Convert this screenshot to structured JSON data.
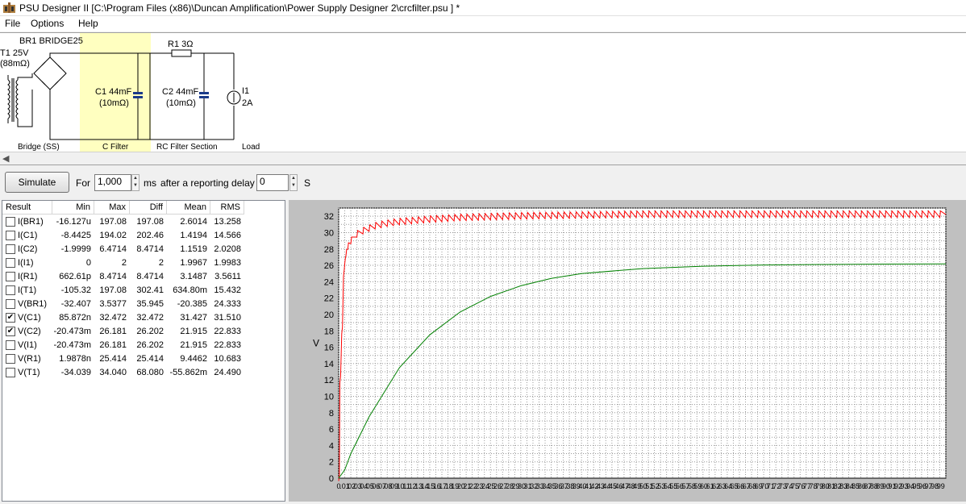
{
  "window": {
    "title": "PSU Designer II  [C:\\Program Files (x86)\\Duncan Amplification\\Power Supply Designer 2\\crcfilter.psu ] *"
  },
  "menu": {
    "file": "File",
    "options": "Options",
    "help": "Help"
  },
  "circuit": {
    "br1": "BR1 BRIDGE25",
    "t1": "T1 25V",
    "t1r": "(88mΩ)",
    "r1": "R1 3Ω",
    "c1": "C1 44mF",
    "c1r": "(10mΩ)",
    "c2": "C2 44mF",
    "c2r": "(10mΩ)",
    "i1": "I1",
    "i1v": "2A",
    "sections": {
      "bridge": "Bridge (SS)",
      "cfilter": "C Filter",
      "rc": "RC Filter Section",
      "load": "Load"
    }
  },
  "toolbar": {
    "simulate": "Simulate",
    "for": "For",
    "duration": "1,000",
    "ms": "ms",
    "after": "after a reporting delay of",
    "delay": "0",
    "s": "S"
  },
  "results": {
    "headers": [
      "Result",
      "Min",
      "Max",
      "Diff",
      "Mean",
      "RMS"
    ],
    "rows": [
      {
        "name": "I(BR1)",
        "checked": false,
        "min": "-16.127u",
        "max": "197.08",
        "diff": "197.08",
        "mean": "2.6014",
        "rms": "13.258"
      },
      {
        "name": "I(C1)",
        "checked": false,
        "min": "-8.4425",
        "max": "194.02",
        "diff": "202.46",
        "mean": "1.4194",
        "rms": "14.566"
      },
      {
        "name": "I(C2)",
        "checked": false,
        "min": "-1.9999",
        "max": "6.4714",
        "diff": "8.4714",
        "mean": "1.1519",
        "rms": "2.0208"
      },
      {
        "name": "I(I1)",
        "checked": false,
        "min": "0",
        "max": "2",
        "diff": "2",
        "mean": "1.9967",
        "rms": "1.9983"
      },
      {
        "name": "I(R1)",
        "checked": false,
        "min": "662.61p",
        "max": "8.4714",
        "diff": "8.4714",
        "mean": "3.1487",
        "rms": "3.5611"
      },
      {
        "name": "I(T1)",
        "checked": false,
        "min": "-105.32",
        "max": "197.08",
        "diff": "302.41",
        "mean": "634.80m",
        "rms": "15.432"
      },
      {
        "name": "V(BR1)",
        "checked": false,
        "min": "-32.407",
        "max": "3.5377",
        "diff": "35.945",
        "mean": "-20.385",
        "rms": "24.333"
      },
      {
        "name": "V(C1)",
        "checked": true,
        "min": "85.872n",
        "max": "32.472",
        "diff": "32.472",
        "mean": "31.427",
        "rms": "31.510"
      },
      {
        "name": "V(C2)",
        "checked": true,
        "min": "-20.473m",
        "max": "26.181",
        "diff": "26.202",
        "mean": "21.915",
        "rms": "22.833"
      },
      {
        "name": "V(I1)",
        "checked": false,
        "min": "-20.473m",
        "max": "26.181",
        "diff": "26.202",
        "mean": "21.915",
        "rms": "22.833"
      },
      {
        "name": "V(R1)",
        "checked": false,
        "min": "1.9878n",
        "max": "25.414",
        "diff": "25.414",
        "mean": "9.4462",
        "rms": "10.683"
      },
      {
        "name": "V(T1)",
        "checked": false,
        "min": "-34.039",
        "max": "34.040",
        "diff": "68.080",
        "mean": "-55.862m",
        "rms": "24.490"
      }
    ]
  },
  "chart_data": {
    "type": "line",
    "ylabel": "V",
    "ylim": [
      0,
      33
    ],
    "xlim": [
      0,
      1
    ],
    "yticks": [
      0,
      2,
      4,
      6,
      8,
      10,
      12,
      14,
      16,
      18,
      20,
      22,
      24,
      26,
      28,
      30,
      32
    ],
    "xtick_step": 0.01,
    "grid": true,
    "series": [
      {
        "name": "V(C1)",
        "color": "#ff0000",
        "x": [
          0,
          0.002,
          0.005,
          0.008,
          0.01,
          0.012,
          0.015,
          0.02,
          0.03,
          0.04,
          0.06,
          0.08,
          0.1,
          0.15,
          0.2,
          0.3,
          0.4,
          0.5,
          0.6,
          0.7,
          0.8,
          0.9,
          1.0
        ],
        "y": [
          0,
          12,
          18,
          25,
          26.5,
          27.5,
          28.3,
          29,
          29.8,
          30.2,
          30.8,
          31.1,
          31.3,
          31.6,
          31.8,
          32,
          32.1,
          32.2,
          32.2,
          32.2,
          32.2,
          32.2,
          32.2
        ]
      },
      {
        "name": "V(C2)",
        "color": "#008000",
        "x": [
          0,
          0.01,
          0.02,
          0.05,
          0.1,
          0.15,
          0.2,
          0.25,
          0.3,
          0.35,
          0.4,
          0.5,
          0.6,
          0.7,
          0.8,
          0.9,
          1.0
        ],
        "y": [
          0,
          1,
          3,
          7.5,
          13.5,
          17.5,
          20.3,
          22.2,
          23.5,
          24.4,
          25,
          25.6,
          25.9,
          26.05,
          26.1,
          26.15,
          26.18
        ]
      }
    ]
  }
}
